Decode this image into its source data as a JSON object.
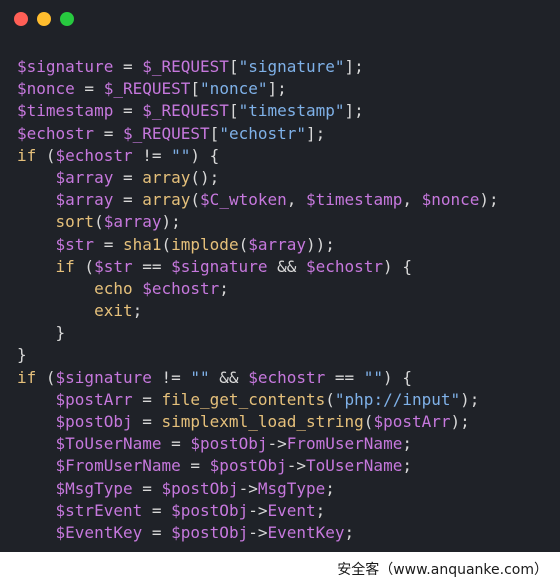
{
  "window": {
    "traffic_lights": [
      {
        "name": "close",
        "color": "#ff5f56"
      },
      {
        "name": "minimize",
        "color": "#ffbd2e"
      },
      {
        "name": "maximize",
        "color": "#27c93f"
      }
    ]
  },
  "code_lines": [
    [
      [
        "var",
        "$signature"
      ],
      [
        "plain",
        " = "
      ],
      [
        "var",
        "$_REQUEST"
      ],
      [
        "plain",
        "["
      ],
      [
        "str",
        "\"signature\""
      ],
      [
        "plain",
        "];"
      ]
    ],
    [
      [
        "var",
        "$nonce"
      ],
      [
        "plain",
        " = "
      ],
      [
        "var",
        "$_REQUEST"
      ],
      [
        "plain",
        "["
      ],
      [
        "str",
        "\"nonce\""
      ],
      [
        "plain",
        "];"
      ]
    ],
    [
      [
        "var",
        "$timestamp"
      ],
      [
        "plain",
        " = "
      ],
      [
        "var",
        "$_REQUEST"
      ],
      [
        "plain",
        "["
      ],
      [
        "str",
        "\"timestamp\""
      ],
      [
        "plain",
        "];"
      ]
    ],
    [
      [
        "var",
        "$echostr"
      ],
      [
        "plain",
        " = "
      ],
      [
        "var",
        "$_REQUEST"
      ],
      [
        "plain",
        "["
      ],
      [
        "str",
        "\"echostr\""
      ],
      [
        "plain",
        "];"
      ]
    ],
    [
      [
        "kw",
        "if"
      ],
      [
        "plain",
        " ("
      ],
      [
        "var",
        "$echostr"
      ],
      [
        "plain",
        " != "
      ],
      [
        "str",
        "\"\""
      ],
      [
        "plain",
        ") {"
      ]
    ],
    [
      [
        "plain",
        "    "
      ],
      [
        "var",
        "$array"
      ],
      [
        "plain",
        " = "
      ],
      [
        "kw",
        "array"
      ],
      [
        "plain",
        "();"
      ]
    ],
    [
      [
        "plain",
        "    "
      ],
      [
        "var",
        "$array"
      ],
      [
        "plain",
        " = "
      ],
      [
        "kw",
        "array"
      ],
      [
        "plain",
        "("
      ],
      [
        "var",
        "$C_wtoken"
      ],
      [
        "plain",
        ", "
      ],
      [
        "var",
        "$timestamp"
      ],
      [
        "plain",
        ", "
      ],
      [
        "var",
        "$nonce"
      ],
      [
        "plain",
        ");"
      ]
    ],
    [
      [
        "plain",
        "    "
      ],
      [
        "kw",
        "sort"
      ],
      [
        "plain",
        "("
      ],
      [
        "var",
        "$array"
      ],
      [
        "plain",
        ");"
      ]
    ],
    [
      [
        "plain",
        "    "
      ],
      [
        "var",
        "$str"
      ],
      [
        "plain",
        " = "
      ],
      [
        "kw",
        "sha1"
      ],
      [
        "plain",
        "("
      ],
      [
        "kw",
        "implode"
      ],
      [
        "plain",
        "("
      ],
      [
        "var",
        "$array"
      ],
      [
        "plain",
        "));"
      ]
    ],
    [
      [
        "plain",
        "    "
      ],
      [
        "kw",
        "if"
      ],
      [
        "plain",
        " ("
      ],
      [
        "var",
        "$str"
      ],
      [
        "plain",
        " == "
      ],
      [
        "var",
        "$signature"
      ],
      [
        "plain",
        " && "
      ],
      [
        "var",
        "$echostr"
      ],
      [
        "plain",
        ") {"
      ]
    ],
    [
      [
        "plain",
        "        "
      ],
      [
        "kw",
        "echo"
      ],
      [
        "plain",
        " "
      ],
      [
        "var",
        "$echostr"
      ],
      [
        "plain",
        ";"
      ]
    ],
    [
      [
        "plain",
        "        "
      ],
      [
        "kw",
        "exit"
      ],
      [
        "plain",
        ";"
      ]
    ],
    [
      [
        "plain",
        "    }"
      ]
    ],
    [
      [
        "plain",
        "}"
      ]
    ],
    [
      [
        "kw",
        "if"
      ],
      [
        "plain",
        " ("
      ],
      [
        "var",
        "$signature"
      ],
      [
        "plain",
        " != "
      ],
      [
        "str",
        "\"\""
      ],
      [
        "plain",
        " && "
      ],
      [
        "var",
        "$echostr"
      ],
      [
        "plain",
        " == "
      ],
      [
        "str",
        "\"\""
      ],
      [
        "plain",
        ") {"
      ]
    ],
    [
      [
        "plain",
        "    "
      ],
      [
        "var",
        "$postArr"
      ],
      [
        "plain",
        " = "
      ],
      [
        "kw",
        "file_get_contents"
      ],
      [
        "plain",
        "("
      ],
      [
        "str",
        "\"php://input\""
      ],
      [
        "plain",
        ");"
      ]
    ],
    [
      [
        "plain",
        "    "
      ],
      [
        "var",
        "$postObj"
      ],
      [
        "plain",
        " = "
      ],
      [
        "kw",
        "simplexml_load_string"
      ],
      [
        "plain",
        "("
      ],
      [
        "var",
        "$postArr"
      ],
      [
        "plain",
        ");"
      ]
    ],
    [
      [
        "plain",
        "    "
      ],
      [
        "var",
        "$ToUserName"
      ],
      [
        "plain",
        " = "
      ],
      [
        "var",
        "$postObj"
      ],
      [
        "plain",
        "->"
      ],
      [
        "var",
        "FromUserName"
      ],
      [
        "plain",
        ";"
      ]
    ],
    [
      [
        "plain",
        "    "
      ],
      [
        "var",
        "$FromUserName"
      ],
      [
        "plain",
        " = "
      ],
      [
        "var",
        "$postObj"
      ],
      [
        "plain",
        "->"
      ],
      [
        "var",
        "ToUserName"
      ],
      [
        "plain",
        ";"
      ]
    ],
    [
      [
        "plain",
        "    "
      ],
      [
        "var",
        "$MsgType"
      ],
      [
        "plain",
        " = "
      ],
      [
        "var",
        "$postObj"
      ],
      [
        "plain",
        "->"
      ],
      [
        "var",
        "MsgType"
      ],
      [
        "plain",
        ";"
      ]
    ],
    [
      [
        "plain",
        "    "
      ],
      [
        "var",
        "$strEvent"
      ],
      [
        "plain",
        " = "
      ],
      [
        "var",
        "$postObj"
      ],
      [
        "plain",
        "->"
      ],
      [
        "var",
        "Event"
      ],
      [
        "plain",
        ";"
      ]
    ],
    [
      [
        "plain",
        "    "
      ],
      [
        "var",
        "$EventKey"
      ],
      [
        "plain",
        " = "
      ],
      [
        "var",
        "$postObj"
      ],
      [
        "plain",
        "->"
      ],
      [
        "var",
        "EventKey"
      ],
      [
        "plain",
        ";"
      ]
    ]
  ],
  "watermark": "安全客（www.anquanke.com）"
}
